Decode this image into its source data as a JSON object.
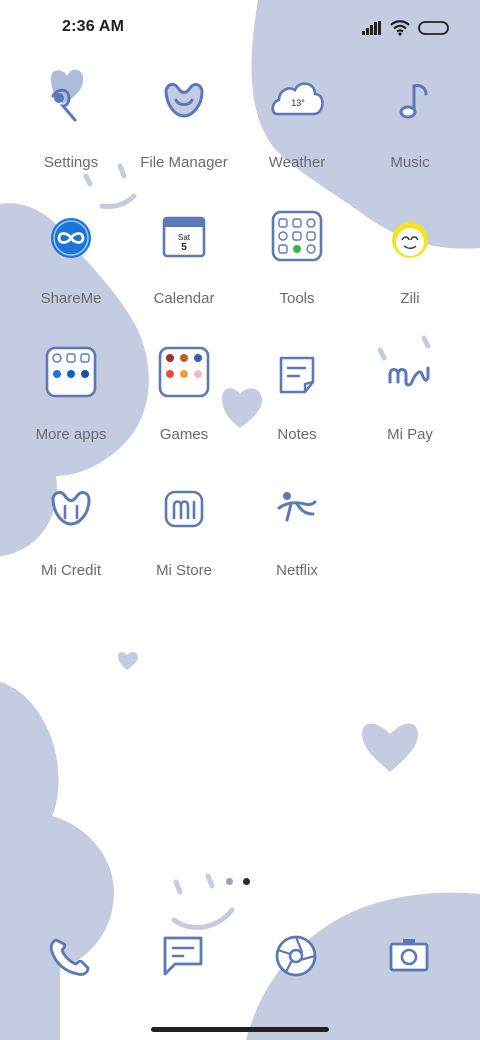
{
  "status_bar": {
    "time": "2:36 AM",
    "icons": [
      "signal-icon",
      "wifi-icon",
      "battery-icon"
    ]
  },
  "apps": [
    {
      "label": "Settings",
      "icon": "settings-icon"
    },
    {
      "label": "File Manager",
      "icon": "file-manager-icon"
    },
    {
      "label": "Weather",
      "icon": "weather-icon",
      "temp": "13°"
    },
    {
      "label": "Music",
      "icon": "music-icon"
    },
    {
      "label": "ShareMe",
      "icon": "shareme-icon"
    },
    {
      "label": "Calendar",
      "icon": "calendar-icon",
      "weekday": "Sat",
      "day": "5"
    },
    {
      "label": "Tools",
      "icon": "tools-folder-icon"
    },
    {
      "label": "Zili",
      "icon": "zili-icon"
    },
    {
      "label": "More apps",
      "icon": "more-apps-folder-icon"
    },
    {
      "label": "Games",
      "icon": "games-folder-icon"
    },
    {
      "label": "Notes",
      "icon": "notes-icon"
    },
    {
      "label": "Mi Pay",
      "icon": "mi-pay-icon"
    },
    {
      "label": "Mi Credit",
      "icon": "mi-credit-icon"
    },
    {
      "label": "Mi Store",
      "icon": "mi-store-icon"
    },
    {
      "label": "Netflix",
      "icon": "netflix-icon"
    }
  ],
  "dock": [
    "phone-icon",
    "messages-icon",
    "browser-icon",
    "camera-icon"
  ],
  "page_indicator": {
    "pages": 2,
    "active": 2
  },
  "colors": {
    "accent": "#5b79b8",
    "wallpaper_blob": "#c2cbe0",
    "label": "#6b6b6b"
  }
}
